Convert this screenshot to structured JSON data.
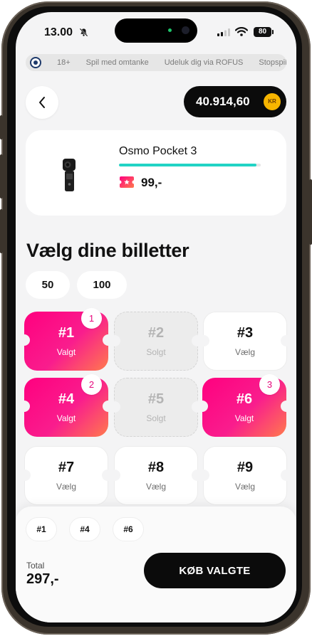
{
  "status_bar": {
    "time": "13.00",
    "battery": "80"
  },
  "info_bar": {
    "items": [
      "18+",
      "Spil med omtanke",
      "Udeluk dig via ROFUS",
      "Stopspillet"
    ]
  },
  "header": {
    "balance": "40.914,60",
    "currency": "KR"
  },
  "product": {
    "name": "Osmo Pocket 3",
    "price": "99,-",
    "progress_fraction": 0.97,
    "progress_color": "#22d3c5"
  },
  "selection": {
    "title": "Vælg dine billetter",
    "quantities": [
      "50",
      "100"
    ]
  },
  "tickets": [
    {
      "number": "#1",
      "status": "Valgt",
      "state": "selected",
      "order": "1"
    },
    {
      "number": "#2",
      "status": "Solgt",
      "state": "sold",
      "order": ""
    },
    {
      "number": "#3",
      "status": "Vælg",
      "state": "available",
      "order": ""
    },
    {
      "number": "#4",
      "status": "Valgt",
      "state": "selected",
      "order": "2"
    },
    {
      "number": "#5",
      "status": "Solgt",
      "state": "sold",
      "order": ""
    },
    {
      "number": "#6",
      "status": "Valgt",
      "state": "selected",
      "order": "3"
    },
    {
      "number": "#7",
      "status": "Vælg",
      "state": "available",
      "order": ""
    },
    {
      "number": "#8",
      "status": "Vælg",
      "state": "available",
      "order": ""
    },
    {
      "number": "#9",
      "status": "Vælg",
      "state": "available",
      "order": ""
    }
  ],
  "cart": {
    "chips": [
      "#1",
      "#4",
      "#6"
    ],
    "total_label": "Total",
    "total_value": "297,-",
    "buy_label": "KØB VALGTE"
  },
  "colors": {
    "accent_pink": "#ff007f",
    "accent_orange": "#ff7a4d",
    "gold": "#f7b500",
    "dark": "#0b0b0b"
  }
}
